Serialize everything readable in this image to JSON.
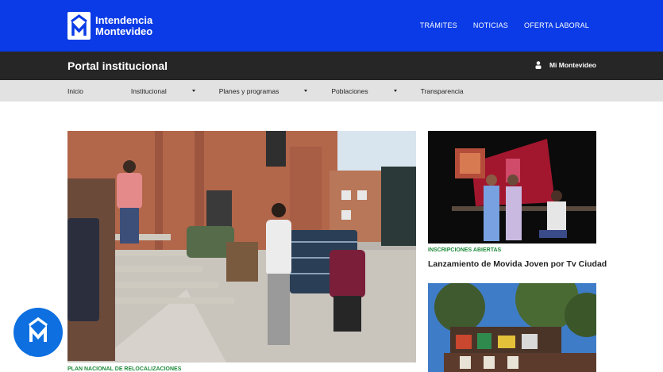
{
  "header": {
    "logo_line1": "Intendencia",
    "logo_line2": "Montevideo",
    "nav": [
      "TRÁMITES",
      "NOTICIAS",
      "OFERTA LABORAL"
    ]
  },
  "portal": {
    "title": "Portal institucional",
    "user_label": "Mi Montevideo"
  },
  "subnav": {
    "items": [
      "Inicio",
      "Institucional",
      "Planes y programas",
      "Poblaciones",
      "Transparencia"
    ]
  },
  "news": {
    "main_tag": "PLAN NACIONAL DE RELOCALIZACIONES",
    "side1_tag": "INSCRIPCIONES ABIERTAS",
    "side1_title": "Lanzamiento de Movida Joven por Tv Ciudad"
  },
  "colors": {
    "brand_blue": "#0a3be6",
    "dark_bar": "#262626",
    "subnav_bg": "#e2e2e2",
    "tag_green": "#1e8a3a"
  },
  "icons": [
    "im-logo-icon",
    "user-icon",
    "caret-down-icon",
    "chat-assistant-icon"
  ]
}
